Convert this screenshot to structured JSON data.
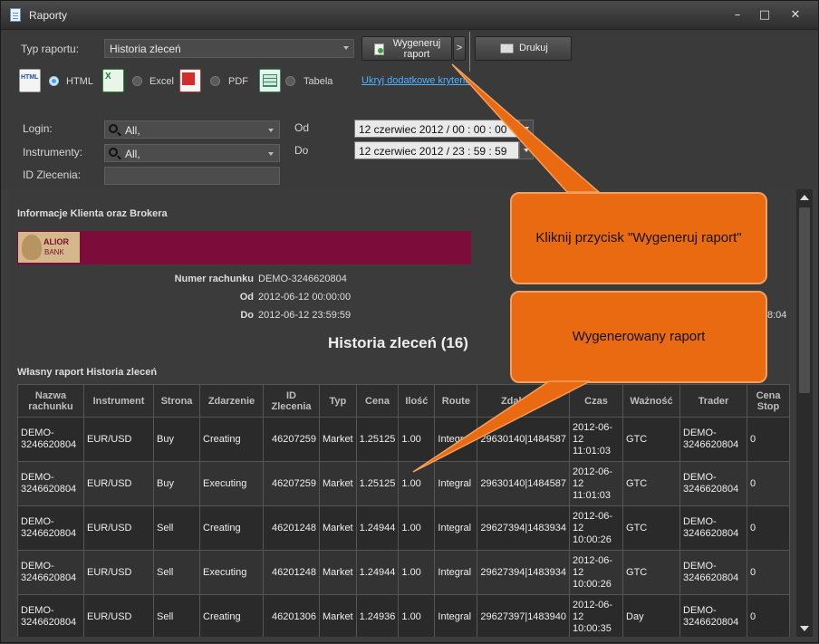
{
  "window": {
    "title": "Raporty",
    "minimize": "–",
    "maximize": "□",
    "close": "✕"
  },
  "toolbar": {
    "report_type_label": "Typ raportu:",
    "report_type_value": "Historia zleceń",
    "generate_label_1": "Wygeneruj",
    "generate_label_2": "raport",
    "more_label": ">",
    "print_label": "Drukuj",
    "formats": [
      {
        "label": "HTML",
        "icon": "html-file-icon",
        "selected": true
      },
      {
        "label": "Excel",
        "icon": "excel-file-icon",
        "selected": false
      },
      {
        "label": "PDF",
        "icon": "pdf-file-icon",
        "selected": false
      },
      {
        "label": "Tabela",
        "icon": "table-file-icon",
        "selected": false
      }
    ],
    "hide_criteria_link": "Ukryj dodatkowe kryteria"
  },
  "filters": {
    "login_label": "Login:",
    "login_value": "All,",
    "instruments_label": "Instrumenty:",
    "instruments_value": "All,",
    "order_id_label": "ID Zlecenia:",
    "order_id_value": "",
    "from_label": "Od",
    "from_value": "12  czerwiec 2012  /  00  :  00  :  00",
    "to_label": "Do",
    "to_value": "12  czerwiec 2012  /  23  :  59  :  59"
  },
  "report": {
    "section_title": "Informacje Klienta oraz Brokera",
    "bank_logo_1": "ALIOR",
    "bank_logo_2": "BANK",
    "account_key": "Numer rachunku",
    "account_value": "DEMO-3246620804",
    "from_key": "Od",
    "from_value": "2012-06-12 00:00:00",
    "to_key": "Do",
    "to_value": "2012-06-12 23:59:59",
    "side_time_fragment": "8:04",
    "main_title": "Historia zleceń (16)",
    "subtitle": "Własny raport Historia zleceń",
    "columns": [
      "Nazwa rachunku",
      "Instrument",
      "Strona",
      "Zdarzenie",
      "ID Zlecenia",
      "Typ",
      "Cena",
      "Ilość",
      "Route",
      "Zdalne ID",
      "Czas",
      "Ważność",
      "Trader",
      "Cena Stop"
    ],
    "rows": [
      [
        "DEMO-3246620804",
        "EUR/USD",
        "Buy",
        "Creating",
        "46207259",
        "Market",
        "1.25125",
        "1.00",
        "Integral",
        "29630140|1484587",
        "2012-06-12 11:01:03",
        "GTC",
        "DEMO-3246620804",
        "0"
      ],
      [
        "DEMO-3246620804",
        "EUR/USD",
        "Buy",
        "Executing",
        "46207259",
        "Market",
        "1.25125",
        "1.00",
        "Integral",
        "29630140|1484587",
        "2012-06-12 11:01:03",
        "GTC",
        "DEMO-3246620804",
        "0"
      ],
      [
        "DEMO-3246620804",
        "EUR/USD",
        "Sell",
        "Creating",
        "46201248",
        "Market",
        "1.24944",
        "1.00",
        "Integral",
        "29627394|1483934",
        "2012-06-12 10:00:26",
        "GTC",
        "DEMO-3246620804",
        "0"
      ],
      [
        "DEMO-3246620804",
        "EUR/USD",
        "Sell",
        "Executing",
        "46201248",
        "Market",
        "1.24944",
        "1.00",
        "Integral",
        "29627394|1483934",
        "2012-06-12 10:00:26",
        "GTC",
        "DEMO-3246620804",
        "0"
      ],
      [
        "DEMO-3246620804",
        "EUR/USD",
        "Sell",
        "Creating",
        "46201306",
        "Market",
        "1.24936",
        "1.00",
        "Integral",
        "29627397|1483940",
        "2012-06-12 10:00:35",
        "Day",
        "DEMO-3246620804",
        "0"
      ]
    ]
  },
  "callouts": {
    "click_generate": "Kliknij przycisk \"Wygeneruj raport\"",
    "generated_report": "Wygenerowany raport"
  },
  "colors": {
    "callout": "#e96a10",
    "banner": "#7c0d3b",
    "link": "#4fb2ff"
  }
}
